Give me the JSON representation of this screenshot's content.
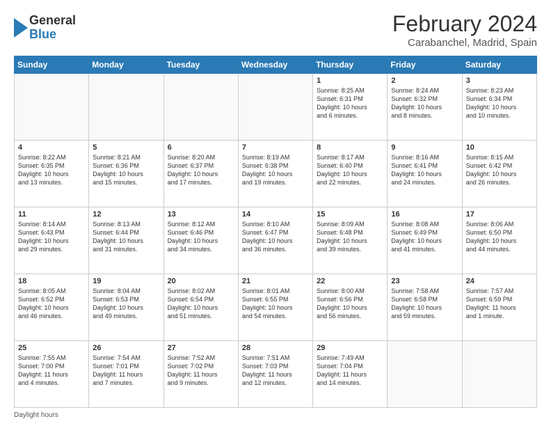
{
  "logo": {
    "general": "General",
    "blue": "Blue"
  },
  "title": "February 2024",
  "subtitle": "Carabanchel, Madrid, Spain",
  "days_header": [
    "Sunday",
    "Monday",
    "Tuesday",
    "Wednesday",
    "Thursday",
    "Friday",
    "Saturday"
  ],
  "weeks": [
    [
      {
        "day": "",
        "info": ""
      },
      {
        "day": "",
        "info": ""
      },
      {
        "day": "",
        "info": ""
      },
      {
        "day": "",
        "info": ""
      },
      {
        "day": "1",
        "info": "Sunrise: 8:25 AM\nSunset: 6:31 PM\nDaylight: 10 hours\nand 6 minutes."
      },
      {
        "day": "2",
        "info": "Sunrise: 8:24 AM\nSunset: 6:32 PM\nDaylight: 10 hours\nand 8 minutes."
      },
      {
        "day": "3",
        "info": "Sunrise: 8:23 AM\nSunset: 6:34 PM\nDaylight: 10 hours\nand 10 minutes."
      }
    ],
    [
      {
        "day": "4",
        "info": "Sunrise: 8:22 AM\nSunset: 6:35 PM\nDaylight: 10 hours\nand 13 minutes."
      },
      {
        "day": "5",
        "info": "Sunrise: 8:21 AM\nSunset: 6:36 PM\nDaylight: 10 hours\nand 15 minutes."
      },
      {
        "day": "6",
        "info": "Sunrise: 8:20 AM\nSunset: 6:37 PM\nDaylight: 10 hours\nand 17 minutes."
      },
      {
        "day": "7",
        "info": "Sunrise: 8:19 AM\nSunset: 6:38 PM\nDaylight: 10 hours\nand 19 minutes."
      },
      {
        "day": "8",
        "info": "Sunrise: 8:17 AM\nSunset: 6:40 PM\nDaylight: 10 hours\nand 22 minutes."
      },
      {
        "day": "9",
        "info": "Sunrise: 8:16 AM\nSunset: 6:41 PM\nDaylight: 10 hours\nand 24 minutes."
      },
      {
        "day": "10",
        "info": "Sunrise: 8:15 AM\nSunset: 6:42 PM\nDaylight: 10 hours\nand 26 minutes."
      }
    ],
    [
      {
        "day": "11",
        "info": "Sunrise: 8:14 AM\nSunset: 6:43 PM\nDaylight: 10 hours\nand 29 minutes."
      },
      {
        "day": "12",
        "info": "Sunrise: 8:13 AM\nSunset: 6:44 PM\nDaylight: 10 hours\nand 31 minutes."
      },
      {
        "day": "13",
        "info": "Sunrise: 8:12 AM\nSunset: 6:46 PM\nDaylight: 10 hours\nand 34 minutes."
      },
      {
        "day": "14",
        "info": "Sunrise: 8:10 AM\nSunset: 6:47 PM\nDaylight: 10 hours\nand 36 minutes."
      },
      {
        "day": "15",
        "info": "Sunrise: 8:09 AM\nSunset: 6:48 PM\nDaylight: 10 hours\nand 39 minutes."
      },
      {
        "day": "16",
        "info": "Sunrise: 8:08 AM\nSunset: 6:49 PM\nDaylight: 10 hours\nand 41 minutes."
      },
      {
        "day": "17",
        "info": "Sunrise: 8:06 AM\nSunset: 6:50 PM\nDaylight: 10 hours\nand 44 minutes."
      }
    ],
    [
      {
        "day": "18",
        "info": "Sunrise: 8:05 AM\nSunset: 6:52 PM\nDaylight: 10 hours\nand 46 minutes."
      },
      {
        "day": "19",
        "info": "Sunrise: 8:04 AM\nSunset: 6:53 PM\nDaylight: 10 hours\nand 49 minutes."
      },
      {
        "day": "20",
        "info": "Sunrise: 8:02 AM\nSunset: 6:54 PM\nDaylight: 10 hours\nand 51 minutes."
      },
      {
        "day": "21",
        "info": "Sunrise: 8:01 AM\nSunset: 6:55 PM\nDaylight: 10 hours\nand 54 minutes."
      },
      {
        "day": "22",
        "info": "Sunrise: 8:00 AM\nSunset: 6:56 PM\nDaylight: 10 hours\nand 56 minutes."
      },
      {
        "day": "23",
        "info": "Sunrise: 7:58 AM\nSunset: 6:58 PM\nDaylight: 10 hours\nand 59 minutes."
      },
      {
        "day": "24",
        "info": "Sunrise: 7:57 AM\nSunset: 6:59 PM\nDaylight: 11 hours\nand 1 minute."
      }
    ],
    [
      {
        "day": "25",
        "info": "Sunrise: 7:55 AM\nSunset: 7:00 PM\nDaylight: 11 hours\nand 4 minutes."
      },
      {
        "day": "26",
        "info": "Sunrise: 7:54 AM\nSunset: 7:01 PM\nDaylight: 11 hours\nand 7 minutes."
      },
      {
        "day": "27",
        "info": "Sunrise: 7:52 AM\nSunset: 7:02 PM\nDaylight: 11 hours\nand 9 minutes."
      },
      {
        "day": "28",
        "info": "Sunrise: 7:51 AM\nSunset: 7:03 PM\nDaylight: 11 hours\nand 12 minutes."
      },
      {
        "day": "29",
        "info": "Sunrise: 7:49 AM\nSunset: 7:04 PM\nDaylight: 11 hours\nand 14 minutes."
      },
      {
        "day": "",
        "info": ""
      },
      {
        "day": "",
        "info": ""
      }
    ]
  ],
  "footer": "Daylight hours"
}
